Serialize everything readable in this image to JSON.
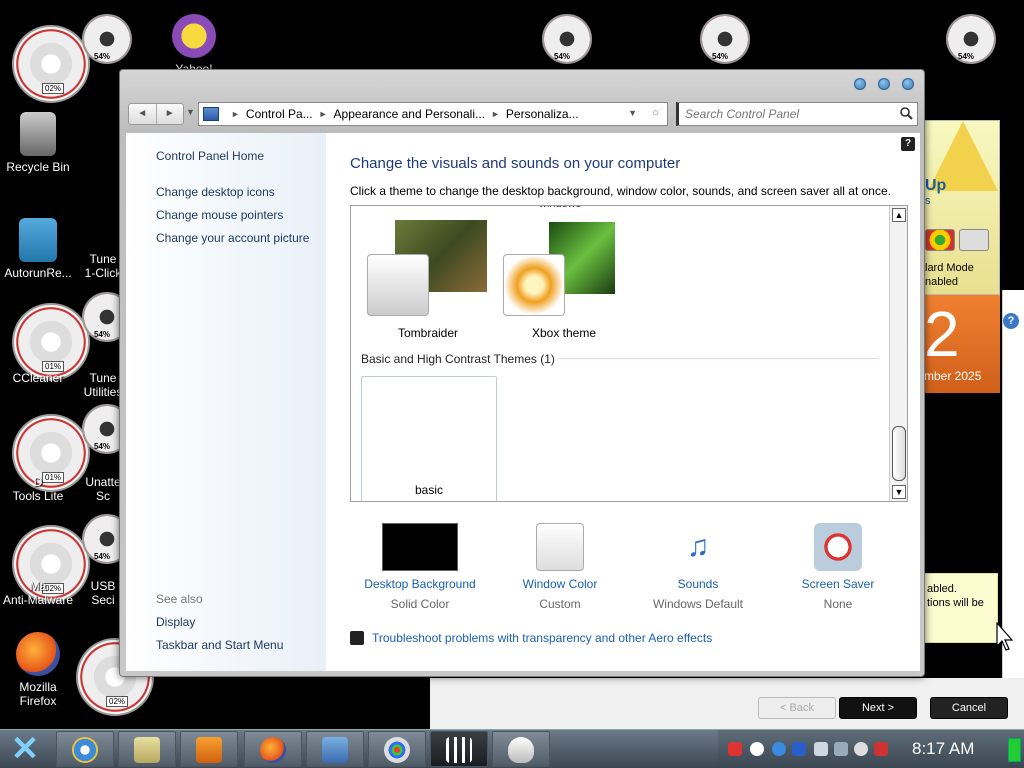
{
  "desktop": {
    "icons": [
      {
        "label": "Yahoo!",
        "name": "yahoo"
      },
      {
        "label": "Recycle Bin",
        "name": "recycle-bin"
      },
      {
        "label": "Te",
        "name": "te"
      },
      {
        "label": "AutorunRe...",
        "name": "autorunre"
      },
      {
        "label": "Tune",
        "name": "tune"
      },
      {
        "label": "1-Click",
        "name": "one-click"
      },
      {
        "label": "CCleaner",
        "name": "ccleaner"
      },
      {
        "label": "Tune",
        "name": "tune2"
      },
      {
        "label": "Utilities",
        "name": "utilities"
      },
      {
        "label": "D",
        "name": "d"
      },
      {
        "label": "Tools Lite",
        "name": "tools-lite"
      },
      {
        "label": "Unatte",
        "name": "unatte"
      },
      {
        "label": "Sc",
        "name": "sc"
      },
      {
        "label": "Ma",
        "name": "ma"
      },
      {
        "label": "Anti-Malware",
        "name": "anti-malware"
      },
      {
        "label": "USB",
        "name": "usb"
      },
      {
        "label": "Seci",
        "name": "seci"
      },
      {
        "label": "Mozilla",
        "name": "mozilla"
      },
      {
        "label": "Firefox",
        "name": "firefox"
      }
    ],
    "gauges": [
      "02%",
      "54%",
      "01%",
      "54%",
      "01%",
      "54%",
      "02%",
      "54%",
      "02%",
      "54%",
      "54%",
      "54%"
    ]
  },
  "gadgets": {
    "yellow_up": "Up",
    "yellow_s": "s",
    "yellow_mode1": "lard Mode",
    "yellow_mode2": "nabled",
    "orange_big": "2",
    "orange_month": "mber 2025",
    "notice1": "abled.",
    "notice2": "tions will be"
  },
  "wizard": {
    "back": "< Back",
    "next": "Next >",
    "cancel": "Cancel"
  },
  "window": {
    "nav": {
      "back": "◄",
      "forward": "►"
    },
    "breadcrumbs": [
      "Control Pa...",
      "Appearance and Personali...",
      "Personaliza..."
    ],
    "search_placeholder": "Search Control Panel",
    "left": {
      "home": "Control Panel Home",
      "links": [
        "Change desktop icons",
        "Change mouse pointers",
        "Change your account picture"
      ],
      "see_also": "See also",
      "see_also_links": [
        "Display",
        "Taskbar and Start Menu"
      ]
    },
    "help": "?",
    "title": "Change the visuals and sounds on your computer",
    "subtitle": "Click a theme to change the desktop background, window color, sounds, and screen saver all at once.",
    "partial_top_label": "windows",
    "themes": [
      {
        "name": "Tombraider"
      },
      {
        "name": "Xbox theme"
      }
    ],
    "basic_section": "Basic and High Contrast Themes (1)",
    "basic_theme": "basic",
    "settings": [
      {
        "label": "Desktop Background",
        "value": "Solid Color"
      },
      {
        "label": "Window Color",
        "value": "Custom"
      },
      {
        "label": "Sounds",
        "value": "Windows Default"
      },
      {
        "label": "Screen Saver",
        "value": "None"
      }
    ],
    "troubleshoot": "Troubleshoot problems with transparency and other Aero effects"
  },
  "taskbar": {
    "start": "✕",
    "clock": "8:17 AM"
  },
  "colors": {
    "link": "#1a5fb4",
    "title": "#1e3a7c",
    "orange": "#e06f25"
  }
}
